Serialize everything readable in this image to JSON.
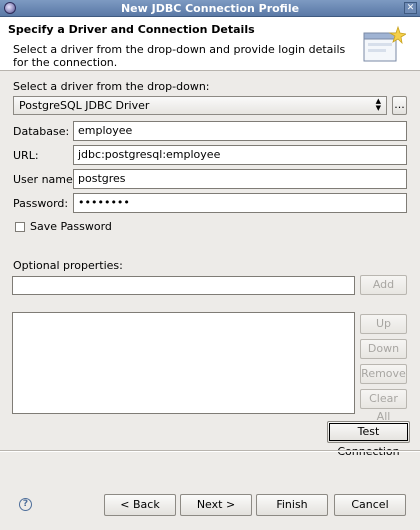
{
  "window": {
    "title": "New JDBC Connection Profile"
  },
  "banner": {
    "heading": "Specify a Driver and Connection Details",
    "description": "Select a driver from the drop-down and provide login details for the connection."
  },
  "driver": {
    "label": "Select a driver from the drop-down:",
    "selected": "PostgreSQL JDBC Driver",
    "browse_label": "..."
  },
  "fields": {
    "database_label": "Database:",
    "database_value": "employee",
    "url_label": "URL:",
    "url_value": "jdbc:postgresql:employee",
    "username_label": "User name:",
    "username_value": "postgres",
    "password_label": "Password:",
    "password_value": "••••••••"
  },
  "save_password": {
    "label": "Save Password",
    "checked": false
  },
  "optional_properties": {
    "label": "Optional properties:",
    "input_value": "",
    "add_label": "Add",
    "up_label": "Up",
    "down_label": "Down",
    "remove_label": "Remove",
    "clear_all_label": "Clear All"
  },
  "test_connection_label": "Test Connection",
  "footer": {
    "back_label": "< Back",
    "next_label": "Next >",
    "finish_label": "Finish",
    "cancel_label": "Cancel"
  },
  "icons": {
    "app": "eclipse-icon",
    "close": "close-icon",
    "wizard": "wizard-banner-icon",
    "help": "help-icon"
  }
}
